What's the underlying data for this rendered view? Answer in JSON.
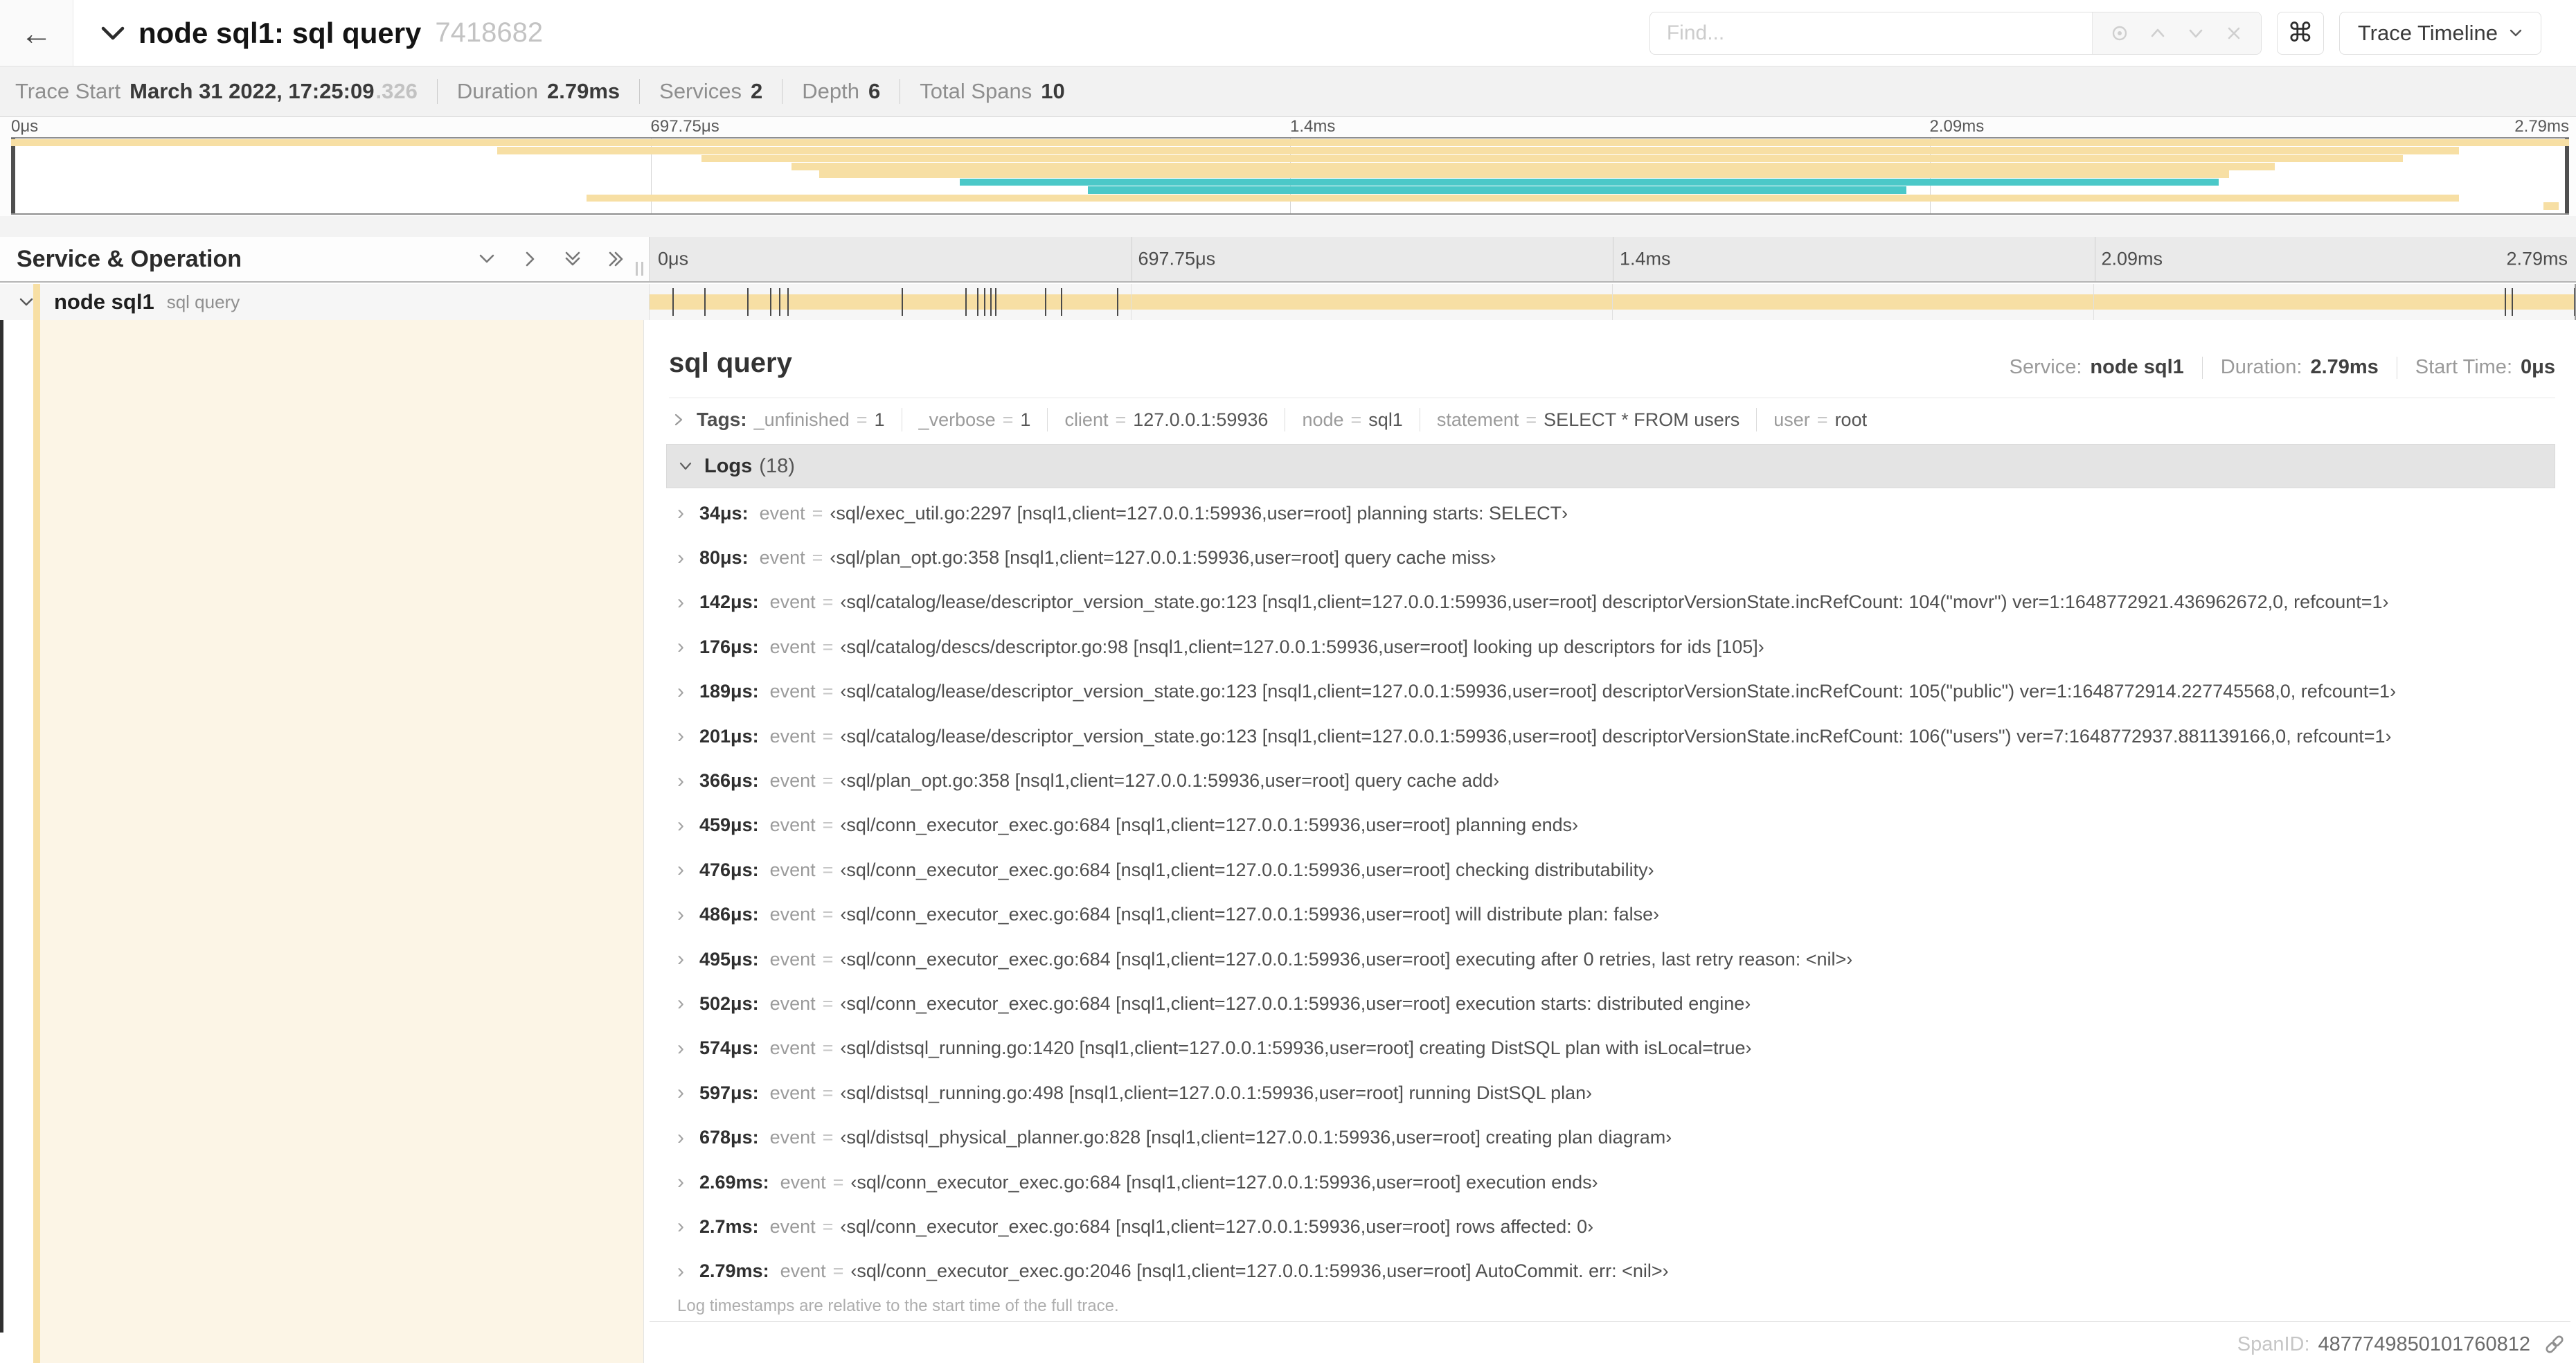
{
  "colors": {
    "tan": "#f7dfa4",
    "teal": "#4bc8c8",
    "cream": "#fcf5e6"
  },
  "icons": {
    "back": "←",
    "command": "⌘",
    "chevron_right": "›",
    "equals_sign": "="
  },
  "header": {
    "title": "node sql1: sql query",
    "trace_id": "7418682",
    "find_placeholder": "Find...",
    "view_selector": "Trace Timeline"
  },
  "trace_info": {
    "items": [
      {
        "label": "Trace Start",
        "value": "March 31 2022, 17:25:09",
        "suffix": ".326"
      },
      {
        "label": "Duration",
        "value": "2.79ms"
      },
      {
        "label": "Services",
        "value": "2"
      },
      {
        "label": "Depth",
        "value": "6"
      },
      {
        "label": "Total Spans",
        "value": "10"
      }
    ]
  },
  "minimap": {
    "ticks": [
      "0μs",
      "697.75μs",
      "1.4ms",
      "2.09ms",
      "2.79ms"
    ],
    "spans": [
      {
        "start": 0,
        "end": 100,
        "color": "tan"
      },
      {
        "start": 19,
        "end": 95.7,
        "color": "tan"
      },
      {
        "start": 27,
        "end": 93.5,
        "color": "tan"
      },
      {
        "start": 30.5,
        "end": 88.5,
        "color": "tan"
      },
      {
        "start": 31.6,
        "end": 86.7,
        "color": "tan"
      },
      {
        "start": 37.1,
        "end": 86.3,
        "color": "teal"
      },
      {
        "start": 42.1,
        "end": 74.1,
        "color": "teal"
      },
      {
        "start": 22.5,
        "end": 95.7,
        "color": "tan"
      },
      {
        "start": 99,
        "end": 99.6,
        "color": "tan"
      }
    ]
  },
  "timeline": {
    "left_header": "Service & Operation",
    "ticks": [
      "0μs",
      "697.75μs",
      "1.4ms",
      "2.09ms",
      "2.79ms"
    ],
    "row": {
      "service": "node sql1",
      "operation": "sql query"
    }
  },
  "detail": {
    "operation": "sql query",
    "meta": [
      {
        "label": "Service:",
        "value": "node sql1"
      },
      {
        "label": "Duration:",
        "value": "2.79ms"
      },
      {
        "label": "Start Time:",
        "value": "0μs"
      }
    ],
    "tags_label": "Tags:",
    "tags": [
      {
        "key": "_unfinished",
        "value": "1"
      },
      {
        "key": "_verbose",
        "value": "1"
      },
      {
        "key": "client",
        "value": "127.0.0.1:59936"
      },
      {
        "key": "node",
        "value": "sql1"
      },
      {
        "key": "statement",
        "value": "SELECT * FROM users"
      },
      {
        "key": "user",
        "value": "root"
      }
    ],
    "logs_label": "Logs",
    "logs_count": "(18)",
    "logs": [
      {
        "time": "34μs:",
        "frac": 0.0122,
        "field": "event",
        "value": "‹sql/exec_util.go:2297 [nsql1,client=127.0.0.1:59936,user=root] planning starts: SELECT›"
      },
      {
        "time": "80μs:",
        "frac": 0.0287,
        "field": "event",
        "value": "‹sql/plan_opt.go:358 [nsql1,client=127.0.0.1:59936,user=root] query cache miss›"
      },
      {
        "time": "142μs:",
        "frac": 0.0509,
        "field": "event",
        "value": "‹sql/catalog/lease/descriptor_version_state.go:123 [nsql1,client=127.0.0.1:59936,user=root] descriptorVersionState.incRefCount: 104(\"movr\") ver=1:1648772921.436962672,0, refcount=1›"
      },
      {
        "time": "176μs:",
        "frac": 0.0631,
        "field": "event",
        "value": "‹sql/catalog/descs/descriptor.go:98 [nsql1,client=127.0.0.1:59936,user=root] looking up descriptors for ids [105]›"
      },
      {
        "time": "189μs:",
        "frac": 0.0677,
        "field": "event",
        "value": "‹sql/catalog/lease/descriptor_version_state.go:123 [nsql1,client=127.0.0.1:59936,user=root] descriptorVersionState.incRefCount: 105(\"public\") ver=1:1648772914.227745568,0, refcount=1›"
      },
      {
        "time": "201μs:",
        "frac": 0.072,
        "field": "event",
        "value": "‹sql/catalog/lease/descriptor_version_state.go:123 [nsql1,client=127.0.0.1:59936,user=root] descriptorVersionState.incRefCount: 106(\"users\") ver=7:1648772937.881139166,0, refcount=1›"
      },
      {
        "time": "366μs:",
        "frac": 0.1312,
        "field": "event",
        "value": "‹sql/plan_opt.go:358 [nsql1,client=127.0.0.1:59936,user=root] query cache add›"
      },
      {
        "time": "459μs:",
        "frac": 0.1645,
        "field": "event",
        "value": "‹sql/conn_executor_exec.go:684 [nsql1,client=127.0.0.1:59936,user=root] planning ends›"
      },
      {
        "time": "476μs:",
        "frac": 0.1706,
        "field": "event",
        "value": "‹sql/conn_executor_exec.go:684 [nsql1,client=127.0.0.1:59936,user=root] checking distributability›"
      },
      {
        "time": "486μs:",
        "frac": 0.1742,
        "field": "event",
        "value": "‹sql/conn_executor_exec.go:684 [nsql1,client=127.0.0.1:59936,user=root] will distribute plan: false›"
      },
      {
        "time": "495μs:",
        "frac": 0.1774,
        "field": "event",
        "value": "‹sql/conn_executor_exec.go:684 [nsql1,client=127.0.0.1:59936,user=root] executing after 0 retries, last retry reason: <nil>›"
      },
      {
        "time": "502μs:",
        "frac": 0.1799,
        "field": "event",
        "value": "‹sql/conn_executor_exec.go:684 [nsql1,client=127.0.0.1:59936,user=root] execution starts: distributed engine›"
      },
      {
        "time": "574μs:",
        "frac": 0.2057,
        "field": "event",
        "value": "‹sql/distsql_running.go:1420 [nsql1,client=127.0.0.1:59936,user=root] creating DistSQL plan with isLocal=true›"
      },
      {
        "time": "597μs:",
        "frac": 0.214,
        "field": "event",
        "value": "‹sql/distsql_running.go:498 [nsql1,client=127.0.0.1:59936,user=root] running DistSQL plan›"
      },
      {
        "time": "678μs:",
        "frac": 0.243,
        "field": "event",
        "value": "‹sql/distsql_physical_planner.go:828 [nsql1,client=127.0.0.1:59936,user=root] creating plan diagram›"
      },
      {
        "time": "2.69ms:",
        "frac": 0.9642,
        "field": "event",
        "value": "‹sql/conn_executor_exec.go:684 [nsql1,client=127.0.0.1:59936,user=root] execution ends›"
      },
      {
        "time": "2.7ms:",
        "frac": 0.9677,
        "field": "event",
        "value": "‹sql/conn_executor_exec.go:684 [nsql1,client=127.0.0.1:59936,user=root] rows affected: 0›"
      },
      {
        "time": "2.79ms:",
        "frac": 1.0,
        "field": "event",
        "value": "‹sql/conn_executor_exec.go:2046 [nsql1,client=127.0.0.1:59936,user=root] AutoCommit. err: <nil>›"
      }
    ],
    "footer_note": "Log timestamps are relative to the start time of the full trace.",
    "span_id_label": "SpanID:",
    "span_id": "4877749850101760812"
  }
}
